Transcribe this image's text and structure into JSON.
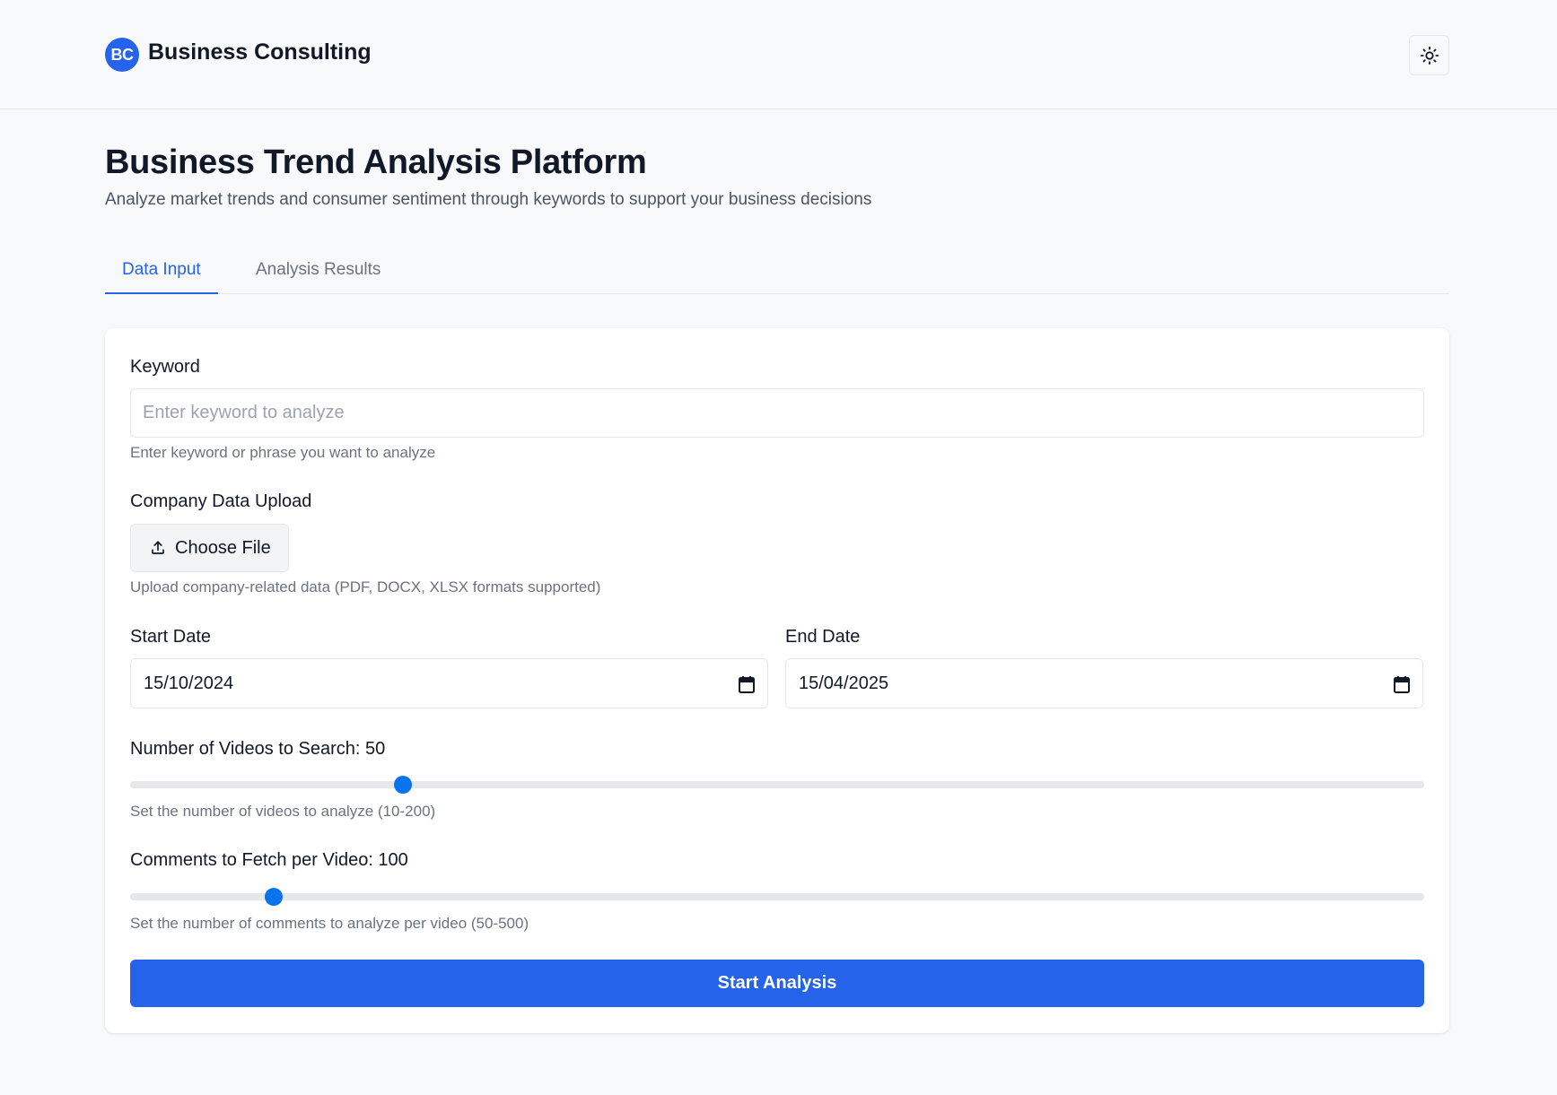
{
  "header": {
    "logo_text": "BC",
    "brand": "Business Consulting",
    "theme_icon": "sun-icon"
  },
  "page": {
    "title": "Business Trend Analysis Platform",
    "subtitle": "Analyze market trends and consumer sentiment through keywords to support your business decisions"
  },
  "tabs": [
    {
      "label": "Data Input",
      "active": true
    },
    {
      "label": "Analysis Results",
      "active": false
    }
  ],
  "form": {
    "keyword": {
      "label": "Keyword",
      "placeholder": "Enter keyword to analyze",
      "value": "",
      "helper": "Enter keyword or phrase you want to analyze"
    },
    "upload": {
      "label": "Company Data Upload",
      "button": "Choose File",
      "icon": "upload-icon",
      "helper": "Upload company-related data (PDF, DOCX, XLSX formats supported)"
    },
    "start_date": {
      "label": "Start Date",
      "value": "15/10/2024",
      "icon": "calendar-icon"
    },
    "end_date": {
      "label": "End Date",
      "value": "15/04/2025",
      "icon": "calendar-icon"
    },
    "videos": {
      "label": "Number of Videos to Search: 50",
      "value": 50,
      "min": 10,
      "max": 200,
      "helper": "Set the number of videos to analyze (10-200)"
    },
    "comments": {
      "label": "Comments to Fetch per Video: 100",
      "value": 100,
      "min": 50,
      "max": 500,
      "helper": "Set the number of comments to analyze per video (50-500)"
    },
    "submit": "Start Analysis"
  },
  "colors": {
    "accent": "#2563eb",
    "slider_thumb": "#0a74f0",
    "background": "#f8f9fb"
  }
}
